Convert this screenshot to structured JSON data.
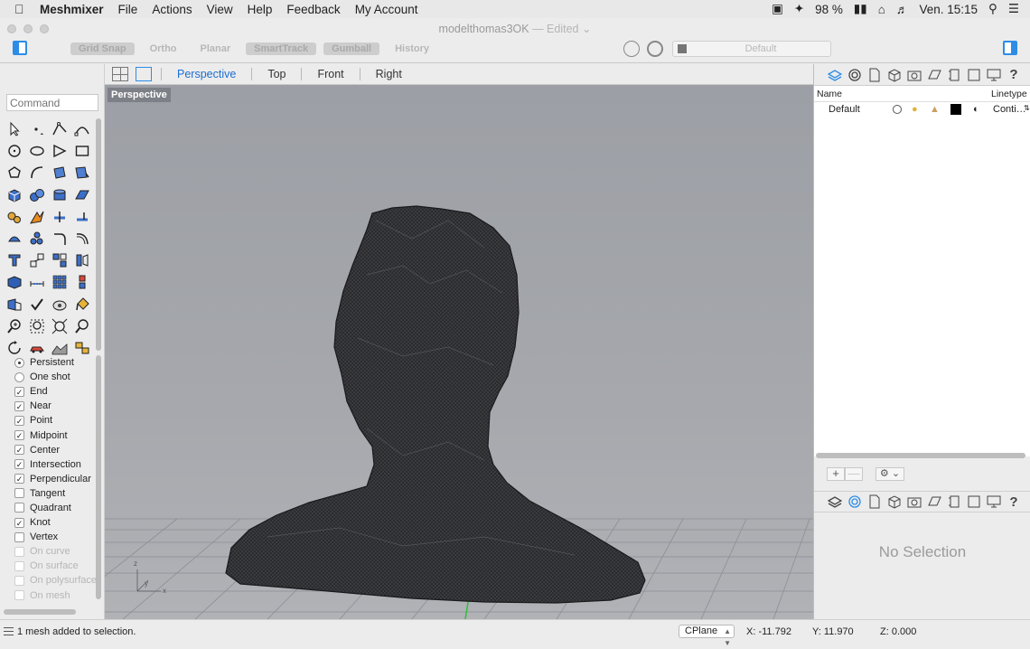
{
  "menubar": {
    "app_name": "Meshmixer",
    "items": [
      "File",
      "Actions",
      "View",
      "Help",
      "Feedback",
      "My Account"
    ],
    "battery": "98 %",
    "clock": "Ven. 15:15"
  },
  "window": {
    "doc_title": "modelthomas3OK",
    "doc_status": "— Edited",
    "toggles": [
      {
        "label": "Grid Snap",
        "on": true
      },
      {
        "label": "Ortho",
        "on": false
      },
      {
        "label": "Planar",
        "on": false
      },
      {
        "label": "SmartTrack",
        "on": true
      },
      {
        "label": "Gumball",
        "on": true
      },
      {
        "label": "History",
        "on": false
      }
    ],
    "current_layer": "Default"
  },
  "left_panel": {
    "command_placeholder": "Command",
    "osnap_modes": [
      {
        "label": "Persistent",
        "type": "radio",
        "checked": true,
        "enabled": true
      },
      {
        "label": "One shot",
        "type": "radio",
        "checked": false,
        "enabled": true
      },
      {
        "label": "End",
        "type": "checkbox",
        "checked": true,
        "enabled": true
      },
      {
        "label": "Near",
        "type": "checkbox",
        "checked": true,
        "enabled": true
      },
      {
        "label": "Point",
        "type": "checkbox",
        "checked": true,
        "enabled": true
      },
      {
        "label": "Midpoint",
        "type": "checkbox",
        "checked": true,
        "enabled": true
      },
      {
        "label": "Center",
        "type": "checkbox",
        "checked": true,
        "enabled": true
      },
      {
        "label": "Intersection",
        "type": "checkbox",
        "checked": true,
        "enabled": true
      },
      {
        "label": "Perpendicular",
        "type": "checkbox",
        "checked": true,
        "enabled": true
      },
      {
        "label": "Tangent",
        "type": "checkbox",
        "checked": false,
        "enabled": true
      },
      {
        "label": "Quadrant",
        "type": "checkbox",
        "checked": false,
        "enabled": true
      },
      {
        "label": "Knot",
        "type": "checkbox",
        "checked": true,
        "enabled": true
      },
      {
        "label": "Vertex",
        "type": "checkbox",
        "checked": false,
        "enabled": true
      },
      {
        "label": "On curve",
        "type": "checkbox",
        "checked": false,
        "enabled": false
      },
      {
        "label": "On surface",
        "type": "checkbox",
        "checked": false,
        "enabled": false
      },
      {
        "label": "On polysurface",
        "type": "checkbox",
        "checked": false,
        "enabled": false
      },
      {
        "label": "On mesh",
        "type": "checkbox",
        "checked": false,
        "enabled": false
      }
    ]
  },
  "viewports": {
    "tabs": [
      "Perspective",
      "Top",
      "Front",
      "Right"
    ],
    "active_tab": "Perspective",
    "label": "Perspective",
    "axis_labels": {
      "z": "z",
      "y": "y",
      "x": "x"
    }
  },
  "layers_panel": {
    "headers": {
      "name": "Name",
      "linetype": "Linetype"
    },
    "layers": [
      {
        "name": "Default",
        "color": "#000000",
        "linetype": "Conti…"
      }
    ],
    "add_label": "+",
    "remove_label": "—",
    "gear_label": "⚙ ⌄"
  },
  "properties_panel": {
    "empty_text": "No Selection"
  },
  "statusbar": {
    "message": "1 mesh added to selection.",
    "cplane": "CPlane",
    "x": "X: -11.792",
    "y": "Y: 11.970",
    "z": "Z: 0.000"
  },
  "colors": {
    "accent": "#2d8ce6",
    "viewport_bg": "#a2a5aa",
    "mesh": "#2a2a2c"
  }
}
